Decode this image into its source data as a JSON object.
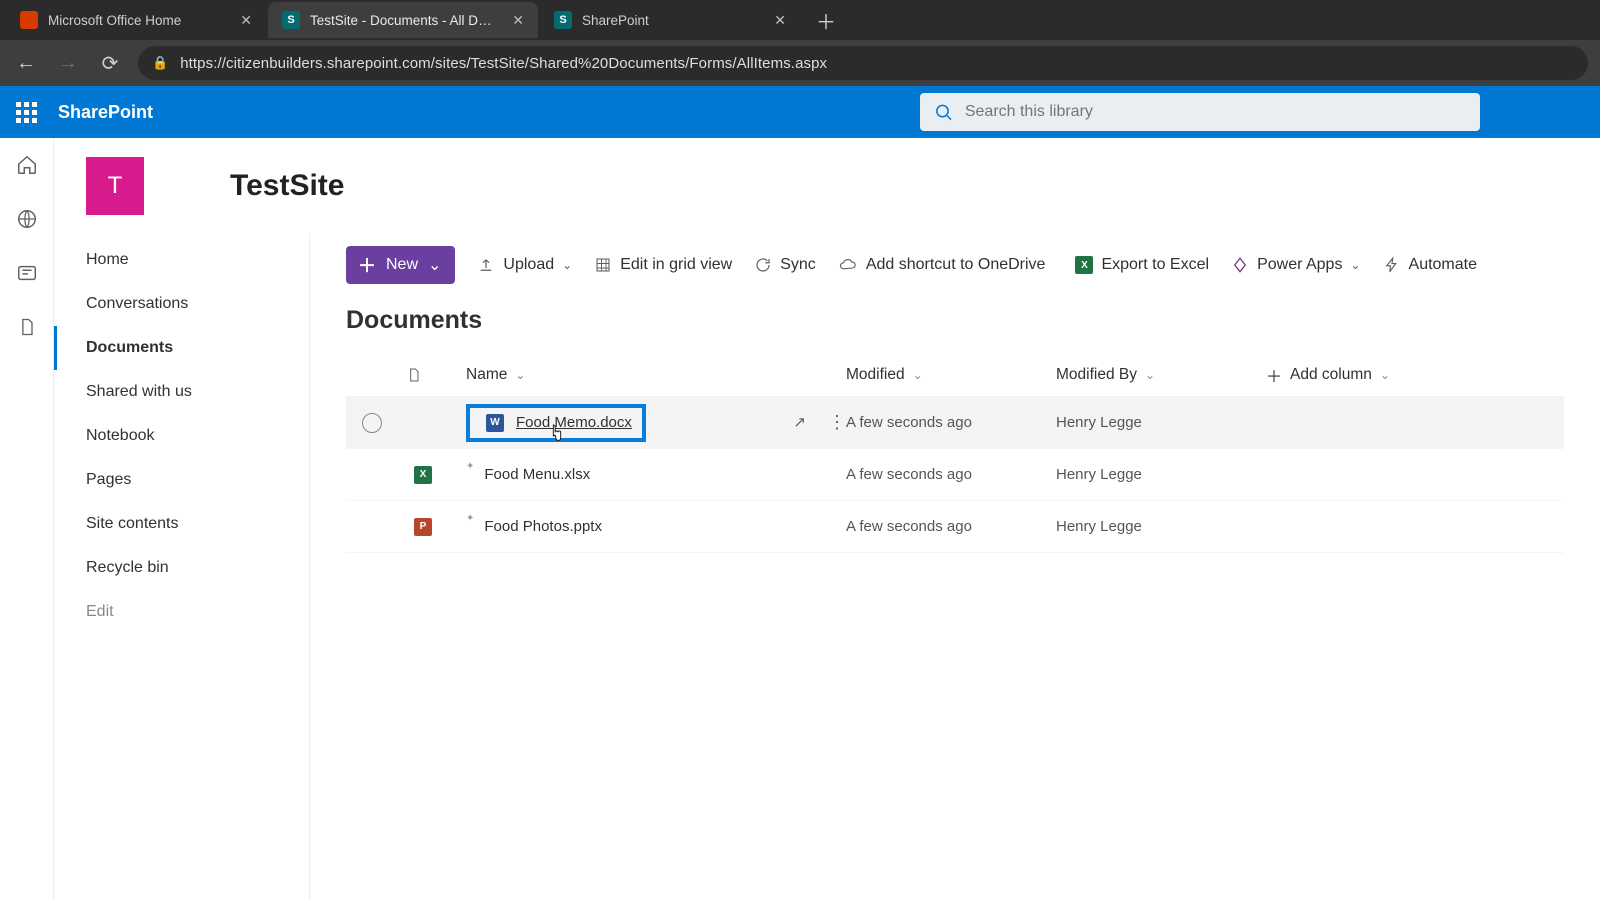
{
  "browser": {
    "tabs": [
      {
        "title": "Microsoft Office Home",
        "favicon_bg": "#d83b01",
        "favicon_text": "",
        "active": false
      },
      {
        "title": "TestSite - Documents - All Docum",
        "favicon_bg": "#036c70",
        "favicon_text": "S",
        "active": true
      },
      {
        "title": "SharePoint",
        "favicon_bg": "#036c70",
        "favicon_text": "S",
        "active": false
      }
    ],
    "url": "https://citizenbuilders.sharepoint.com/sites/TestSite/Shared%20Documents/Forms/AllItems.aspx"
  },
  "suite": {
    "brand": "SharePoint",
    "search_placeholder": "Search this library"
  },
  "site": {
    "logo_letter": "T",
    "logo_bg": "#d81b8c",
    "title": "TestSite"
  },
  "nav": {
    "items": [
      {
        "label": "Home"
      },
      {
        "label": "Conversations"
      },
      {
        "label": "Documents",
        "active": true
      },
      {
        "label": "Shared with us"
      },
      {
        "label": "Notebook"
      },
      {
        "label": "Pages"
      },
      {
        "label": "Site contents"
      },
      {
        "label": "Recycle bin"
      },
      {
        "label": "Edit",
        "muted": true
      }
    ]
  },
  "commands": {
    "new": "New",
    "upload": "Upload",
    "edit_grid": "Edit in grid view",
    "sync": "Sync",
    "shortcut": "Add shortcut to OneDrive",
    "export": "Export to Excel",
    "powerapps": "Power Apps",
    "automate": "Automate"
  },
  "library": {
    "title": "Documents",
    "columns": {
      "name": "Name",
      "modified": "Modified",
      "modified_by": "Modified By",
      "add_column": "Add column"
    },
    "rows": [
      {
        "icon_bg": "#2b579a",
        "icon_text": "W",
        "name": "Food Memo.docx",
        "modified": "A few seconds ago",
        "modified_by": "Henry Legge",
        "hovered": true,
        "highlighted": true
      },
      {
        "icon_bg": "#217346",
        "icon_text": "X",
        "name": "Food Menu.xlsx",
        "modified": "A few seconds ago",
        "modified_by": "Henry Legge"
      },
      {
        "icon_bg": "#b7472a",
        "icon_text": "P",
        "name": "Food Photos.pptx",
        "modified": "A few seconds ago",
        "modified_by": "Henry Legge"
      }
    ]
  }
}
